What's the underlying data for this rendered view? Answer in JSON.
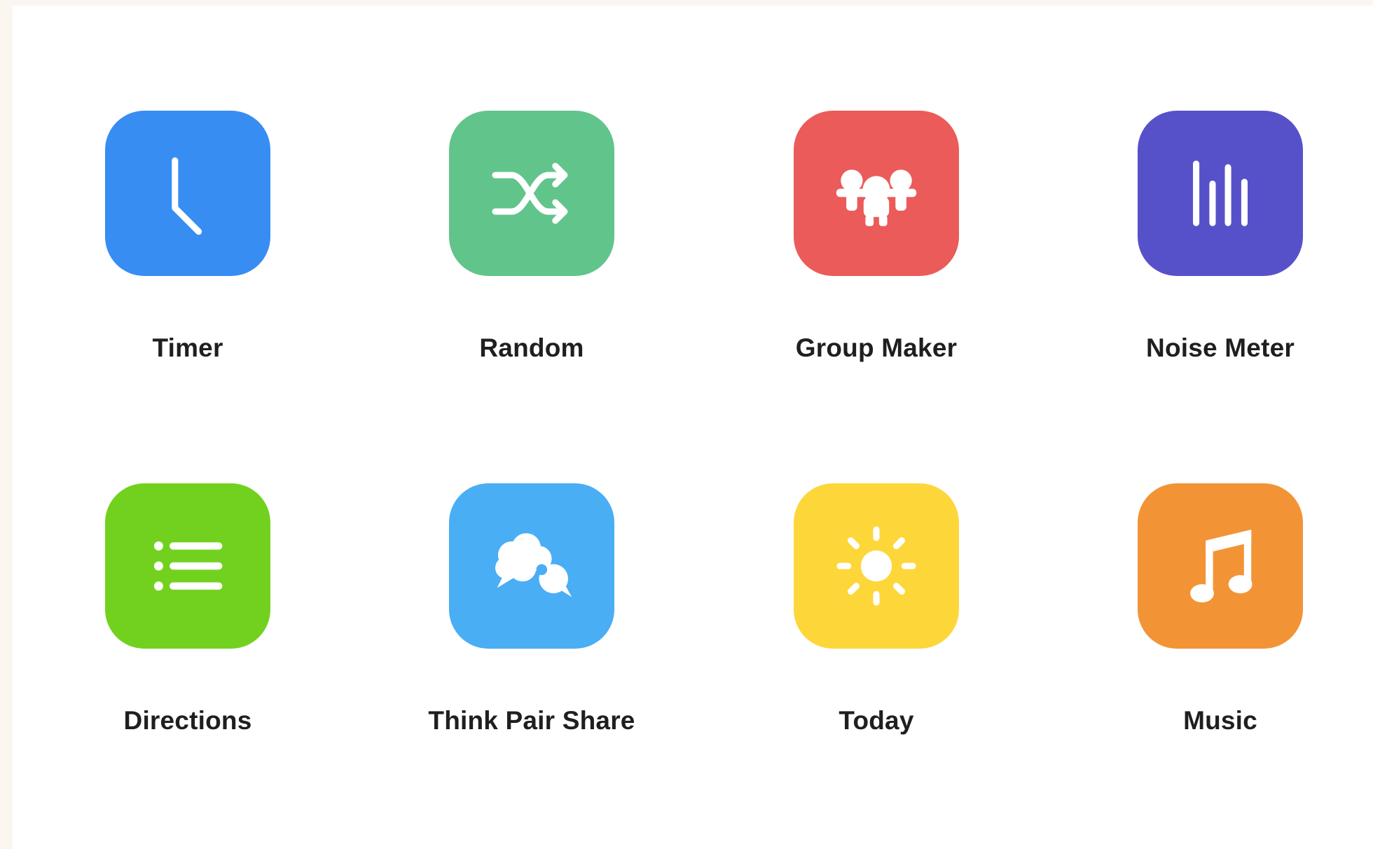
{
  "tools": [
    {
      "id": "timer",
      "label": "Timer",
      "icon": "clock-icon",
      "color": "#388df2"
    },
    {
      "id": "random",
      "label": "Random",
      "icon": "shuffle-icon",
      "color": "#61c48b"
    },
    {
      "id": "group-maker",
      "label": "Group Maker",
      "icon": "group-people-icon",
      "color": "#eb5b59"
    },
    {
      "id": "noise-meter",
      "label": "Noise Meter",
      "icon": "sound-bars-icon",
      "color": "#5751c9"
    },
    {
      "id": "directions",
      "label": "Directions",
      "icon": "list-icon",
      "color": "#72d11e"
    },
    {
      "id": "think-pair-share",
      "label": "Think Pair Share",
      "icon": "thought-bubbles-icon",
      "color": "#49aef4"
    },
    {
      "id": "today",
      "label": "Today",
      "icon": "sun-icon",
      "color": "#fdd73a"
    },
    {
      "id": "music",
      "label": "Music",
      "icon": "music-note-icon",
      "color": "#f29436"
    }
  ]
}
